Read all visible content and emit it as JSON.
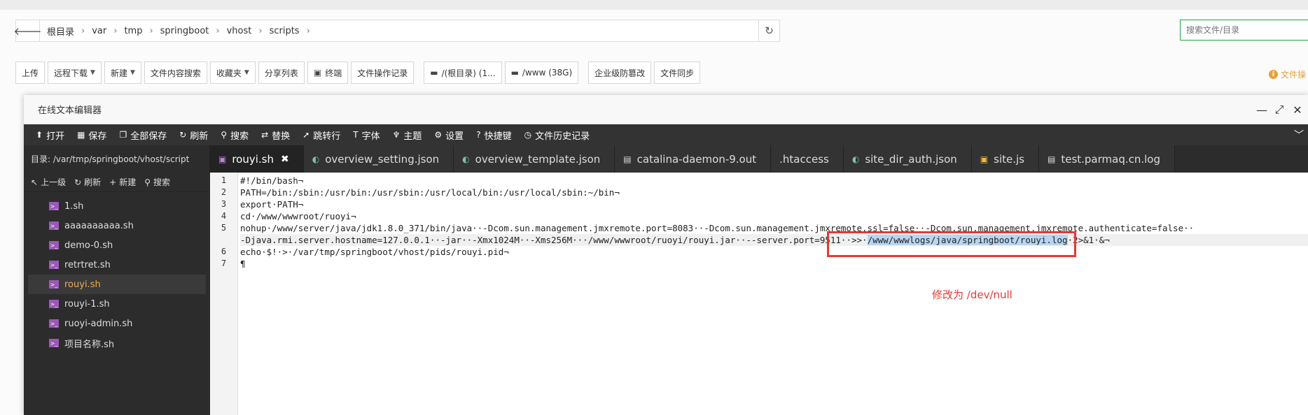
{
  "breadcrumb": {
    "items": [
      "根目录",
      "var",
      "tmp",
      "springboot",
      "vhost",
      "scripts"
    ]
  },
  "search": {
    "placeholder": "搜索文件/目录"
  },
  "toolbar": {
    "buttons": [
      "上传",
      "远程下载",
      "新建",
      "文件内容搜索",
      "收藏夹",
      "分享列表",
      "终端",
      "文件操作记录",
      "/(根目录) (1...",
      "/www (38G)",
      "企业级防篡改",
      "文件同步"
    ]
  },
  "notice": "文件操",
  "editor": {
    "title": "在线文本编辑器",
    "menu": [
      "打开",
      "保存",
      "全部保存",
      "刷新",
      "搜索",
      "替换",
      "跳转行",
      "字体",
      "主题",
      "设置",
      "快捷键",
      "文件历史记录"
    ],
    "directory": "目录: /var/tmp/springboot/vhost/script",
    "tabs": [
      "rouyi.sh",
      "overview_setting.json",
      "overview_template.json",
      "catalina-daemon-9.out",
      ".htaccess",
      "site_dir_auth.json",
      "site.js",
      "test.parmaq.cn.log"
    ],
    "tree_actions": [
      "上一级",
      "刷新",
      "新建",
      "搜索"
    ],
    "files": [
      "1.sh",
      "aaaaaaaaaa.sh",
      "demo-0.sh",
      "retrtret.sh",
      "rouyi.sh",
      "rouyi-1.sh",
      "ruoyi-admin.sh",
      "项目名称.sh"
    ],
    "line_numbers": [
      "1",
      "2",
      "3",
      "4",
      "5",
      "6",
      "7"
    ],
    "code": {
      "l1": "#!/bin/bash¬",
      "l2": "PATH=/bin:/sbin:/usr/bin:/usr/sbin:/usr/local/bin:/usr/local/sbin:~/bin¬",
      "l3": "export·PATH¬",
      "l4": "cd·/www/wwwroot/ruoyi¬",
      "l5a": "nohup·/www/server/java/jdk1.8.0_371/bin/java··-Dcom.sun.management.jmxremote.port=8083··-Dcom.sun.management.jmxremote.ssl=false··-Dcom.sun.management.jmxremote.authenticate=false··",
      "l5b_pre": "-Djava.rmi.server.hostname=127.0.0.1··-jar··-Xmx1024M··-Xms256M···/www/wwwroot/ruoyi/rouyi.jar··--server.port=9511··>>·",
      "l5b_hl": "/www/wwwlogs/java/springboot/rouyi.log",
      "l5b_post": "·2>&1·&¬",
      "l6": "echo·$!·>·/var/tmp/springboot/vhost/pids/rouyi.pid¬",
      "l7": "¶"
    }
  },
  "annotation": "修改为 /dev/null"
}
